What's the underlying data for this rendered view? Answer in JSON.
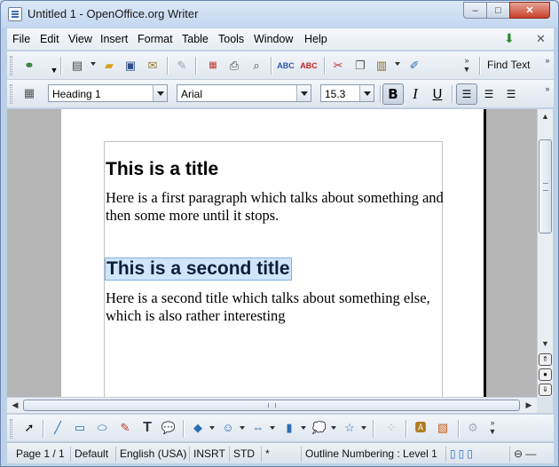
{
  "window": {
    "title": "Untitled 1 - OpenOffice.org Writer",
    "minimize": "–",
    "maximize": "□",
    "close": "✕"
  },
  "menubar": {
    "items": [
      "File",
      "Edit",
      "View",
      "Insert",
      "Format",
      "Table",
      "Tools",
      "Window",
      "Help"
    ],
    "doc_close": "✕"
  },
  "standard_toolbar": {
    "find_text_label": "Find Text"
  },
  "formatting_toolbar": {
    "paragraph_style": "Heading 1",
    "font_name": "Arial",
    "font_size": "15.3",
    "bold_label": "B",
    "italic_label": "I",
    "underline_label": "U"
  },
  "document": {
    "heading_1": "This is a title",
    "paragraph_1": "Here is a first paragraph which talks about something and then some more until it stops.",
    "heading_2": "This is a second title",
    "paragraph_2": "Here is a second title which talks about something else, which is also rather interesting"
  },
  "statusbar": {
    "page": "Page 1 / 1",
    "page_style": "Default",
    "language": "English (USA)",
    "insert_mode": "INSRT",
    "selection_mode": "STD",
    "modified": "*",
    "outline": "Outline Numbering : Level 1"
  },
  "colors": {
    "selection": "#cfe5f9",
    "close_button": "#c7412a"
  }
}
